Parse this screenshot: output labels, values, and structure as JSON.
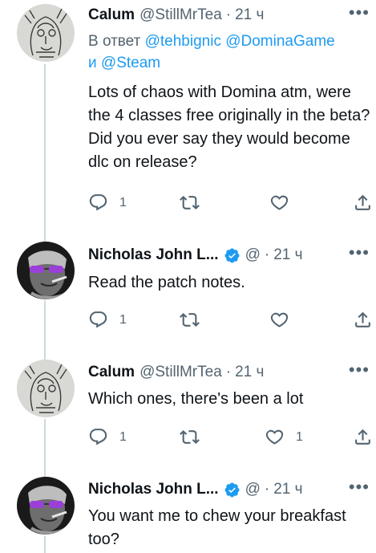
{
  "tweets": [
    {
      "name": "Calum",
      "handle": "@StillMrTea",
      "separator": "·",
      "time": "21 ч",
      "more": "•••",
      "reply_prefix": "В ответ",
      "mentions": [
        "@tehbignic",
        "@DominaGame"
      ],
      "reply_and": "и",
      "mention_last": "@Steam",
      "text": "Lots of chaos with Domina atm, were the 4 classes free originally in the beta? Did you ever say they would become dlc on release?",
      "reply_count": "1",
      "retweet_count": "",
      "like_count": ""
    },
    {
      "name": "Nicholas John L...",
      "handle": "@",
      "separator": "·",
      "time": "21 ч",
      "more": "•••",
      "verified": true,
      "text": "Read the patch notes.",
      "reply_count": "1",
      "retweet_count": "",
      "like_count": ""
    },
    {
      "name": "Calum",
      "handle": "@StillMrTea",
      "separator": "·",
      "time": "21 ч",
      "more": "•••",
      "text": "Which ones, there's been a lot",
      "reply_count": "1",
      "retweet_count": "",
      "like_count": "1"
    },
    {
      "name": "Nicholas John L...",
      "handle": "@",
      "separator": "·",
      "time": "21 ч",
      "more": "•••",
      "verified": true,
      "text": "You want me to chew your breakfast too?"
    }
  ],
  "colors": {
    "link": "#1d9bf0",
    "secondary_text": "#536471",
    "thread_line": "#cfd9de",
    "verified_badge": "#1d9bf0"
  },
  "icons": {
    "reply": "reply-icon",
    "retweet": "retweet-icon",
    "like": "heart-icon",
    "share": "share-icon",
    "verified": "verified-badge-icon"
  }
}
